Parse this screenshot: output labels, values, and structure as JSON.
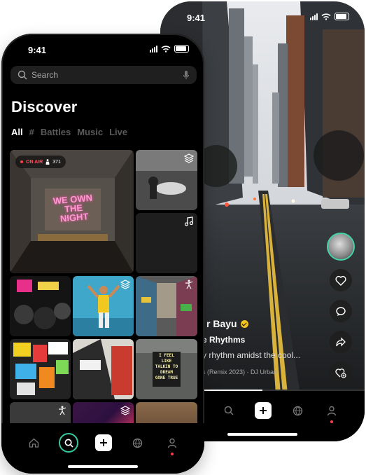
{
  "status_bar": {
    "time": "9:41"
  },
  "back_screen": {
    "creator_name": "r Bayu",
    "track_title": "e Rhythms",
    "description": "y rhythm amidst the cool...",
    "music_credit": "s (Remix 2023)  ·  DJ Urban",
    "progress_fraction": 0.5,
    "actions": [
      "like-icon",
      "comment-icon",
      "share-icon",
      "add-friend-icon"
    ]
  },
  "front_screen": {
    "search": {
      "placeholder": "Search"
    },
    "title": "Discover",
    "tabs": [
      {
        "label": "All",
        "active": true
      },
      {
        "label": "#",
        "active": false
      },
      {
        "label": "Battles",
        "active": false
      },
      {
        "label": "Music",
        "active": false
      },
      {
        "label": "Live",
        "active": false
      }
    ],
    "live_badge": {
      "status": "ON AIR",
      "viewers": "371"
    },
    "tile_texts": {
      "neon": "WE OWN THE NIGHT",
      "pixel_sign": "I FEEL LIKE TALKIN TO DREAM GONE TRUE"
    },
    "nav": [
      "home",
      "search",
      "create",
      "explore",
      "profile"
    ],
    "accent": "#37c8a0",
    "alert": "#ff3b4a"
  }
}
